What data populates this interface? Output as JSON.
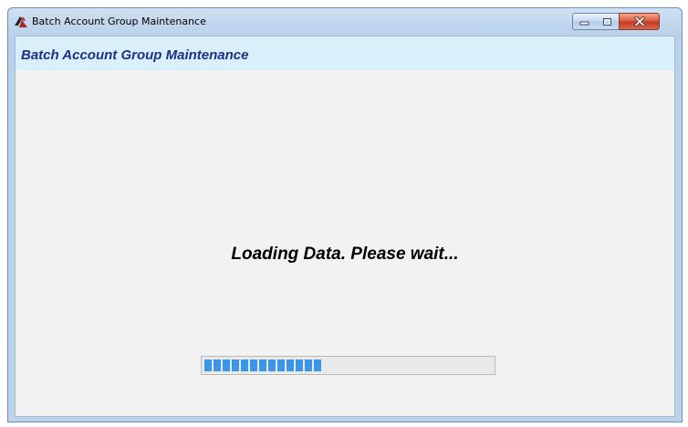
{
  "window": {
    "title": "Batch Account Group Maintenance",
    "app_icon": "app-logo-icon",
    "controls": {
      "minimize": "minimize-icon",
      "maximize": "maximize-icon",
      "close": "close-icon"
    }
  },
  "header": {
    "title": "Batch Account Group Maintenance"
  },
  "status": {
    "message": "Loading Data.  Please wait..."
  },
  "progress": {
    "fraction": 0.4
  },
  "colors": {
    "header_band": "#d9f0fa",
    "header_text": "#1f2f8a",
    "progress_fill": "#3a96e6",
    "client_bg": "#f2f2f2"
  }
}
